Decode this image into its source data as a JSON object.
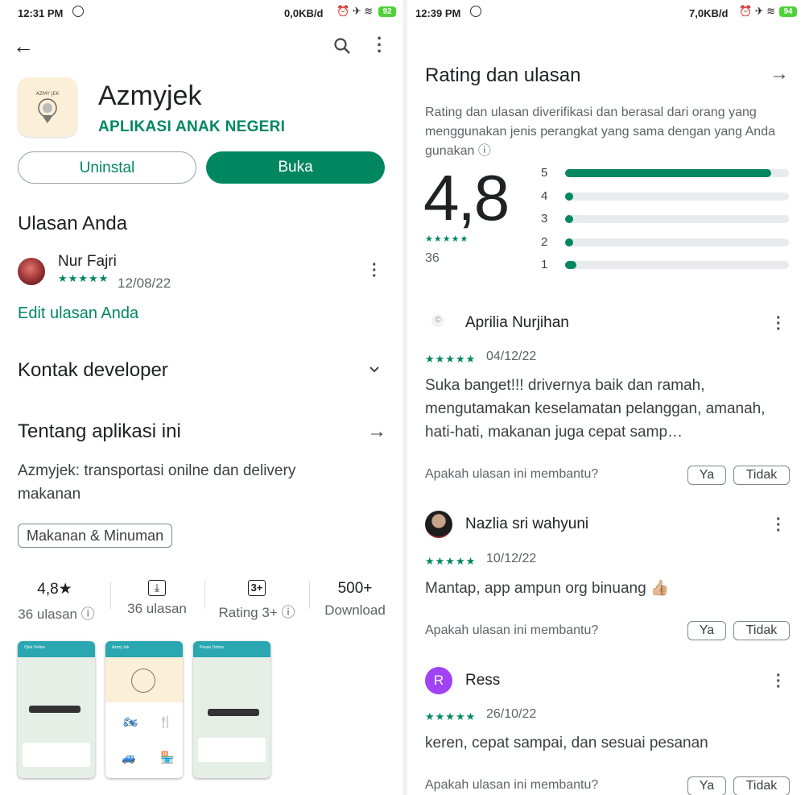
{
  "left": {
    "status": {
      "time": "12:31 PM",
      "net": "0,0KB/d",
      "battery": "92"
    },
    "app": {
      "name": "Azmyjek",
      "developer": "APLIKASI ANAK NEGERI",
      "icon_name": "azmy-jek-logo"
    },
    "buttons": {
      "uninstall": "Uninstal",
      "open": "Buka"
    },
    "your_review": {
      "heading": "Ulasan Anda",
      "user": "Nur Fajri",
      "stars": "★★★★★",
      "date": "12/08/22",
      "edit": "Edit ulasan Anda"
    },
    "contact": {
      "heading": "Kontak developer"
    },
    "about": {
      "heading": "Tentang aplikasi ini",
      "description": "Azmyjek: transportasi onilne dan delivery makanan",
      "category": "Makanan & Minuman"
    },
    "stats": [
      {
        "top": "4,8★",
        "bottom": "36 ulasan ⓘ"
      },
      {
        "top": "⤓",
        "bottom": "36 ulasan"
      },
      {
        "top": "3+",
        "bottom": "Rating 3+ ⓘ"
      },
      {
        "top": "500+",
        "bottom": "Download"
      }
    ],
    "screenshots": [
      "Ojek Online",
      "Azmy Jek",
      "Pesan Online"
    ]
  },
  "right": {
    "status": {
      "time": "12:39 PM",
      "net": "7,0KB/d",
      "battery": "94"
    },
    "ratings": {
      "heading": "Rating dan ulasan",
      "info": "Rating dan ulasan diverifikasi dan berasal dari orang yang menggunakan jenis perangkat yang sama dengan yang Anda gunakan ⓘ",
      "score": "4,8",
      "stars": "★★★★★",
      "count": "36",
      "bars": [
        {
          "label": "5",
          "fraction": 0.92
        },
        {
          "label": "4",
          "fraction": 0.03
        },
        {
          "label": "3",
          "fraction": 0.03
        },
        {
          "label": "2",
          "fraction": 0.03
        },
        {
          "label": "1",
          "fraction": 0.05
        }
      ]
    },
    "helpful_question": "Apakah ulasan ini membantu?",
    "yes": "Ya",
    "no": "Tidak",
    "reviews": [
      {
        "name": "Aprilia Nurjihan",
        "stars": "★★★★★",
        "date": "04/12/22",
        "text": "Suka banget!!! drivernya baik dan ramah, mengutamakan keselamatan pelanggan, amanah, hati-hati, makanan juga cepat samp…"
      },
      {
        "name": "Nazlia sri wahyuni",
        "stars": "★★★★★",
        "date": "10/12/22",
        "text": "Mantap, app ampun org binuang 👍🏼"
      },
      {
        "name": "Ress",
        "initial": "R",
        "stars": "★★★★★",
        "date": "26/10/22",
        "text": "keren, cepat sampai, dan sesuai pesanan"
      }
    ]
  },
  "colors": {
    "accent": "#01875f",
    "avatar_r": "#a142f4",
    "track": "#e8eaed"
  }
}
